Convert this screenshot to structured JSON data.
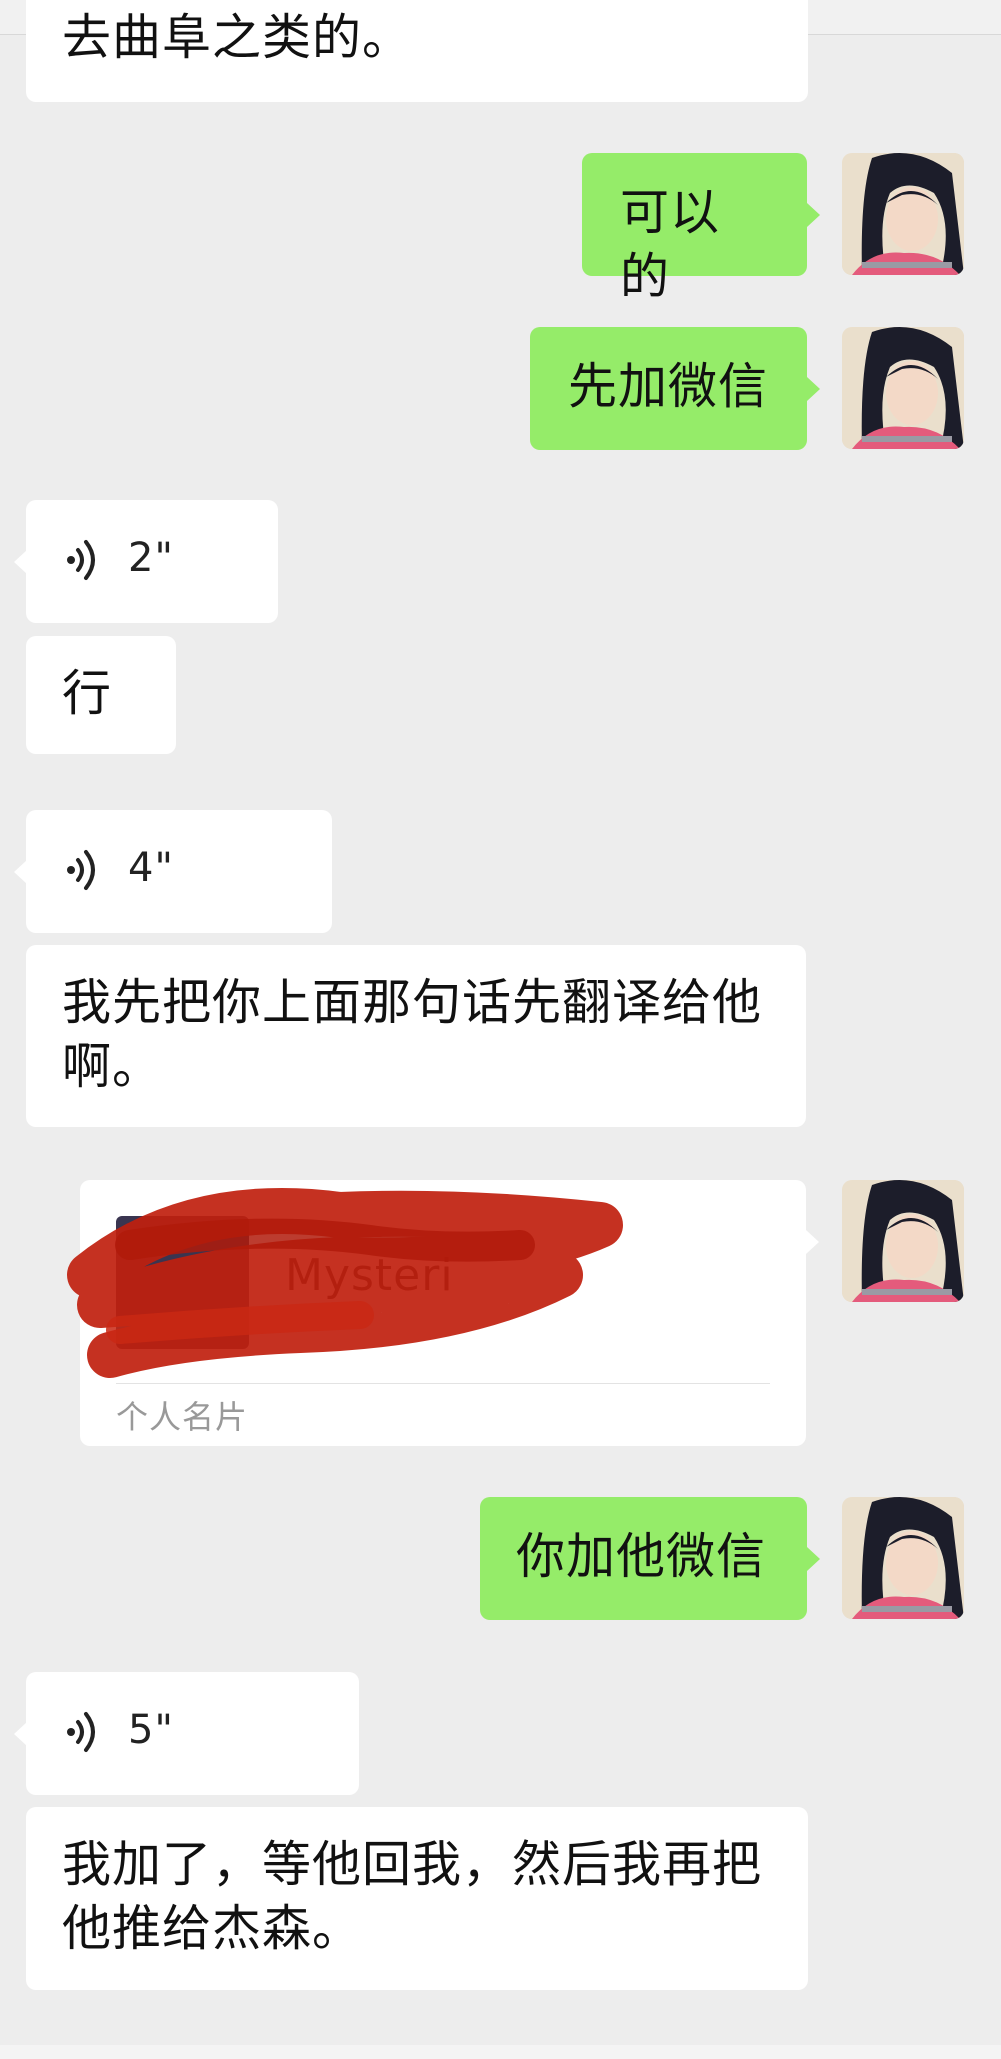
{
  "chat": {
    "messages": [
      {
        "id": "m1",
        "side": "in",
        "type": "text",
        "text": "去曲阜之类的。"
      },
      {
        "id": "m2",
        "side": "out",
        "type": "text",
        "text": "可以的"
      },
      {
        "id": "m3",
        "side": "out",
        "type": "text",
        "text": "先加微信"
      },
      {
        "id": "m4",
        "side": "in",
        "type": "voice",
        "duration": "2\""
      },
      {
        "id": "m5",
        "side": "in",
        "type": "text",
        "text": "行"
      },
      {
        "id": "m6",
        "side": "in",
        "type": "voice",
        "duration": "4\""
      },
      {
        "id": "m7",
        "side": "in",
        "type": "text",
        "text": "我先把你上面那句话先翻译给他啊。"
      },
      {
        "id": "m8",
        "side": "out",
        "type": "contact_card",
        "name": "Mysteri",
        "label": "个人名片"
      },
      {
        "id": "m9",
        "side": "out",
        "type": "text",
        "text": "你加他微信"
      },
      {
        "id": "m10",
        "side": "in",
        "type": "voice",
        "duration": "5\""
      },
      {
        "id": "m11",
        "side": "in",
        "type": "text",
        "text": "我加了，等他回我，然后我再把他推给杰森。"
      }
    ]
  },
  "colors": {
    "background": "#ededed",
    "incoming_bubble": "#ffffff",
    "outgoing_bubble": "#95ec69",
    "redaction": "#c0200e"
  },
  "icons": {
    "voice": "voice-wave-icon",
    "avatar": "user-avatar"
  }
}
